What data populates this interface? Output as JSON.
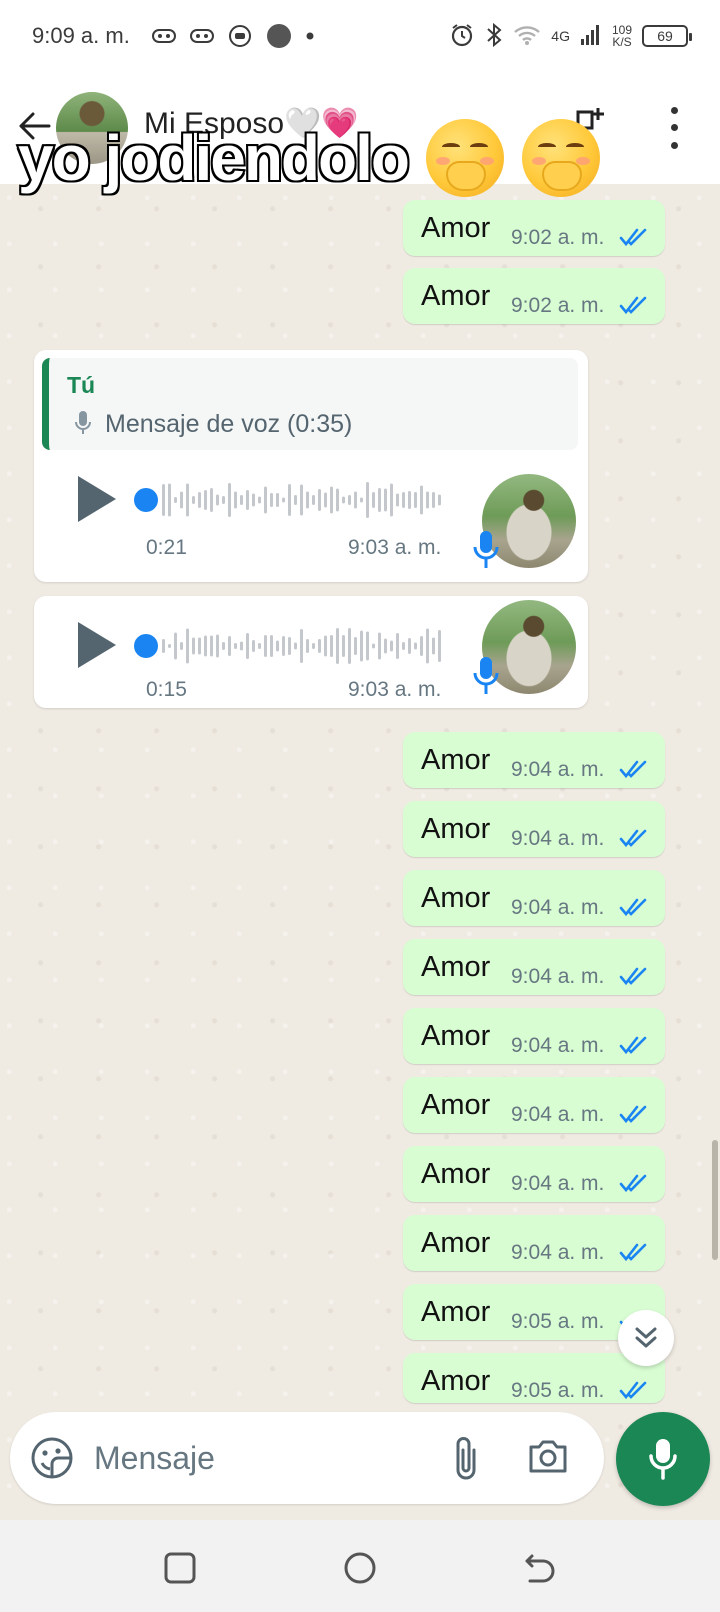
{
  "status_bar": {
    "time": "9:09 a. m.",
    "network": "4G",
    "speed_value": "109",
    "speed_unit": "K/S",
    "battery": "69"
  },
  "header": {
    "contact_name": "Mi Esposo🤍💗"
  },
  "overlay": {
    "caption": "yo jodiendolo",
    "emoji_icon": "face-with-hand-over-mouth-icon"
  },
  "messages_top": [
    {
      "text": "Amor",
      "time": "9:02 a. m."
    },
    {
      "text": "Amor",
      "time": "9:02 a. m."
    }
  ],
  "voice_messages": [
    {
      "quote_author": "Tú",
      "quote_text": "Mensaje de voz (0:35)",
      "duration": "0:21",
      "time": "9:03 a. m.",
      "progress": 0.0
    },
    {
      "duration": "0:15",
      "time": "9:03 a. m.",
      "progress": 0.0
    }
  ],
  "messages_bottom": [
    {
      "text": "Amor",
      "time": "9:04 a. m."
    },
    {
      "text": "Amor",
      "time": "9:04 a. m."
    },
    {
      "text": "Amor",
      "time": "9:04 a. m."
    },
    {
      "text": "Amor",
      "time": "9:04 a. m."
    },
    {
      "text": "Amor",
      "time": "9:04 a. m."
    },
    {
      "text": "Amor",
      "time": "9:04 a. m."
    },
    {
      "text": "Amor",
      "time": "9:04 a. m."
    },
    {
      "text": "Amor",
      "time": "9:04 a. m."
    },
    {
      "text": "Amor",
      "time": "9:05 a. m."
    },
    {
      "text": "Amor",
      "time": "9:05 a. m."
    }
  ],
  "composer": {
    "placeholder": "Mensaje"
  },
  "colors": {
    "accent": "#1b8755",
    "outgoing_bubble": "#d9fdd3",
    "read_ticks": "#53bdeb",
    "voice_dot": "#1a85f2"
  }
}
